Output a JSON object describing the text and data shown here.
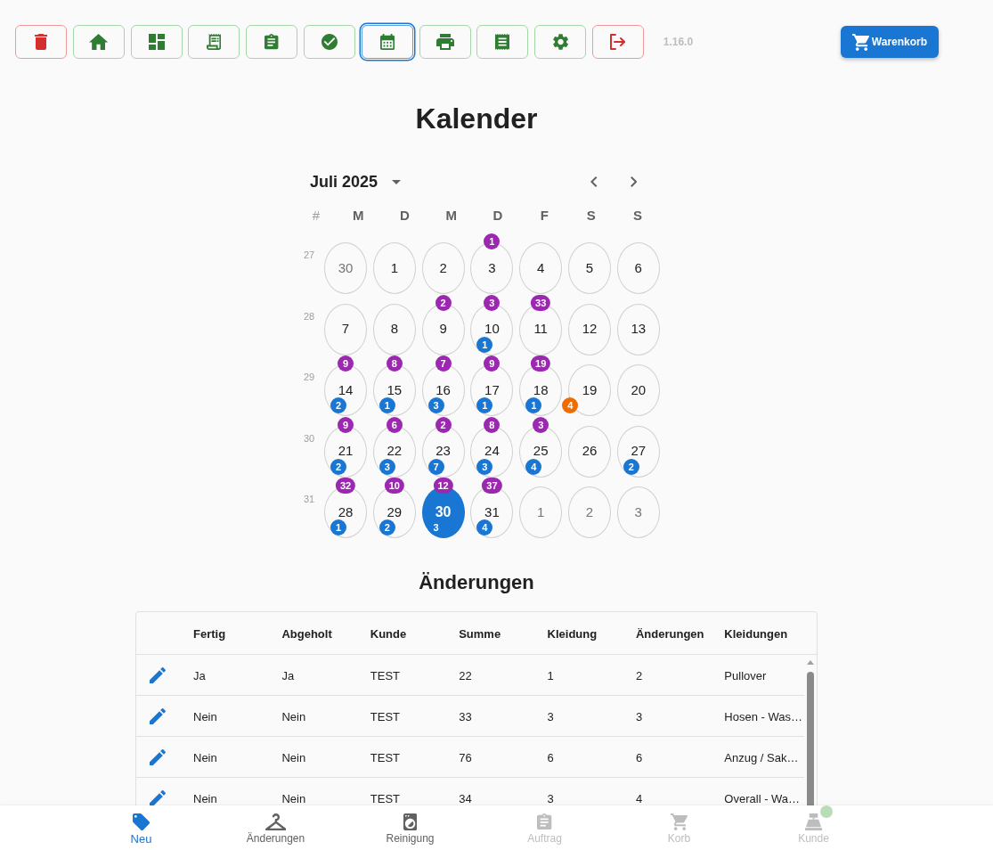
{
  "toolbar": {
    "buttons": [
      {
        "kind": "danger",
        "selected": false
      },
      {
        "kind": "default",
        "selected": false
      },
      {
        "kind": "default",
        "selected": false
      },
      {
        "kind": "default",
        "selected": false
      },
      {
        "kind": "default",
        "selected": false
      },
      {
        "kind": "default",
        "selected": false
      },
      {
        "kind": "default",
        "selected": true
      },
      {
        "kind": "default",
        "selected": false
      },
      {
        "kind": "default",
        "selected": false
      },
      {
        "kind": "default",
        "selected": false
      },
      {
        "kind": "danger",
        "selected": false
      }
    ],
    "version": "1.16.0",
    "cart_button": {
      "label": "Warenkorb"
    }
  },
  "title": "Kalender",
  "calendar": {
    "month": "Juli 2025",
    "week_label": "#",
    "weekdays": [
      "M",
      "D",
      "M",
      "D",
      "F",
      "S",
      "S"
    ],
    "weeks": [
      {
        "number": "27",
        "days": [
          {
            "day": "30",
            "outside": true,
            "selected": false
          },
          {
            "day": "1",
            "outside": false,
            "selected": false
          },
          {
            "day": "2",
            "outside": false,
            "selected": false
          },
          {
            "day": "3",
            "outside": false,
            "selected": false,
            "top_badge": "1"
          },
          {
            "day": "4",
            "outside": false,
            "selected": false
          },
          {
            "day": "5",
            "outside": false,
            "selected": false
          },
          {
            "day": "6",
            "outside": false,
            "selected": false
          }
        ]
      },
      {
        "number": "28",
        "days": [
          {
            "day": "7",
            "outside": false,
            "selected": false
          },
          {
            "day": "8",
            "outside": false,
            "selected": false
          },
          {
            "day": "9",
            "outside": false,
            "selected": false,
            "top_badge": "2"
          },
          {
            "day": "10",
            "outside": false,
            "selected": false,
            "top_badge": "3",
            "bottom_badge": "1"
          },
          {
            "day": "11",
            "outside": false,
            "selected": false,
            "top_badge": "33"
          },
          {
            "day": "12",
            "outside": false,
            "selected": false
          },
          {
            "day": "13",
            "outside": false,
            "selected": false
          }
        ]
      },
      {
        "number": "29",
        "days": [
          {
            "day": "14",
            "outside": false,
            "selected": false,
            "top_badge": "9",
            "bottom_badge": "2"
          },
          {
            "day": "15",
            "outside": false,
            "selected": false,
            "top_badge": "8",
            "bottom_badge": "1"
          },
          {
            "day": "16",
            "outside": false,
            "selected": false,
            "top_badge": "7",
            "bottom_badge": "3"
          },
          {
            "day": "17",
            "outside": false,
            "selected": false,
            "top_badge": "9",
            "bottom_badge": "1"
          },
          {
            "day": "18",
            "outside": false,
            "selected": false,
            "top_badge": "19",
            "bottom_badge": "1",
            "corner_badge": "4"
          },
          {
            "day": "19",
            "outside": false,
            "selected": false
          },
          {
            "day": "20",
            "outside": false,
            "selected": false
          }
        ]
      },
      {
        "number": "30",
        "days": [
          {
            "day": "21",
            "outside": false,
            "selected": false,
            "top_badge": "9",
            "bottom_badge": "2"
          },
          {
            "day": "22",
            "outside": false,
            "selected": false,
            "top_badge": "6",
            "bottom_badge": "3"
          },
          {
            "day": "23",
            "outside": false,
            "selected": false,
            "top_badge": "2",
            "bottom_badge": "7"
          },
          {
            "day": "24",
            "outside": false,
            "selected": false,
            "top_badge": "8",
            "bottom_badge": "3"
          },
          {
            "day": "25",
            "outside": false,
            "selected": false,
            "top_badge": "3",
            "bottom_badge": "4"
          },
          {
            "day": "26",
            "outside": false,
            "selected": false
          },
          {
            "day": "27",
            "outside": false,
            "selected": false,
            "bottom_badge": "2"
          }
        ]
      },
      {
        "number": "31",
        "days": [
          {
            "day": "28",
            "outside": false,
            "selected": false,
            "top_badge": "32",
            "bottom_badge": "1"
          },
          {
            "day": "29",
            "outside": false,
            "selected": false,
            "top_badge": "10",
            "bottom_badge": "2"
          },
          {
            "day": "30",
            "outside": false,
            "selected": true,
            "top_badge": "12",
            "bottom_badge": "3"
          },
          {
            "day": "31",
            "outside": false,
            "selected": false,
            "top_badge": "37",
            "bottom_badge": "4"
          },
          {
            "day": "1",
            "outside": true,
            "selected": false
          },
          {
            "day": "2",
            "outside": true,
            "selected": false
          },
          {
            "day": "3",
            "outside": true,
            "selected": false
          }
        ]
      }
    ]
  },
  "changes": {
    "title": "Änderungen",
    "columns": [
      "Fertig",
      "Abgeholt",
      "Kunde",
      "Summe",
      "Kleidung",
      "Änderungen",
      "Kleidungen"
    ],
    "rows": [
      {
        "cells": [
          "Ja",
          "Ja",
          "TEST",
          "22",
          "1",
          "2",
          "Pullover"
        ]
      },
      {
        "cells": [
          "Nein",
          "Nein",
          "TEST",
          "33",
          "3",
          "3",
          "Hosen - Was…"
        ]
      },
      {
        "cells": [
          "Nein",
          "Nein",
          "TEST",
          "76",
          "6",
          "6",
          "Anzug / Sak…"
        ]
      },
      {
        "cells": [
          "Nein",
          "Nein",
          "TEST",
          "34",
          "3",
          "4",
          "Overall - Wa…"
        ]
      }
    ]
  },
  "bottom_nav": {
    "items": [
      {
        "label": "Neu",
        "selected": true,
        "disabled": false,
        "badge_dot": false
      },
      {
        "label": "Änderungen",
        "selected": false,
        "disabled": false,
        "badge_dot": false
      },
      {
        "label": "Reinigung",
        "selected": false,
        "disabled": false,
        "badge_dot": false
      },
      {
        "label": "Auftrag",
        "selected": false,
        "disabled": true,
        "badge_dot": false
      },
      {
        "label": "Korb",
        "selected": false,
        "disabled": true,
        "badge_dot": false
      },
      {
        "label": "Kunde",
        "selected": false,
        "disabled": true,
        "badge_dot": true
      }
    ]
  }
}
